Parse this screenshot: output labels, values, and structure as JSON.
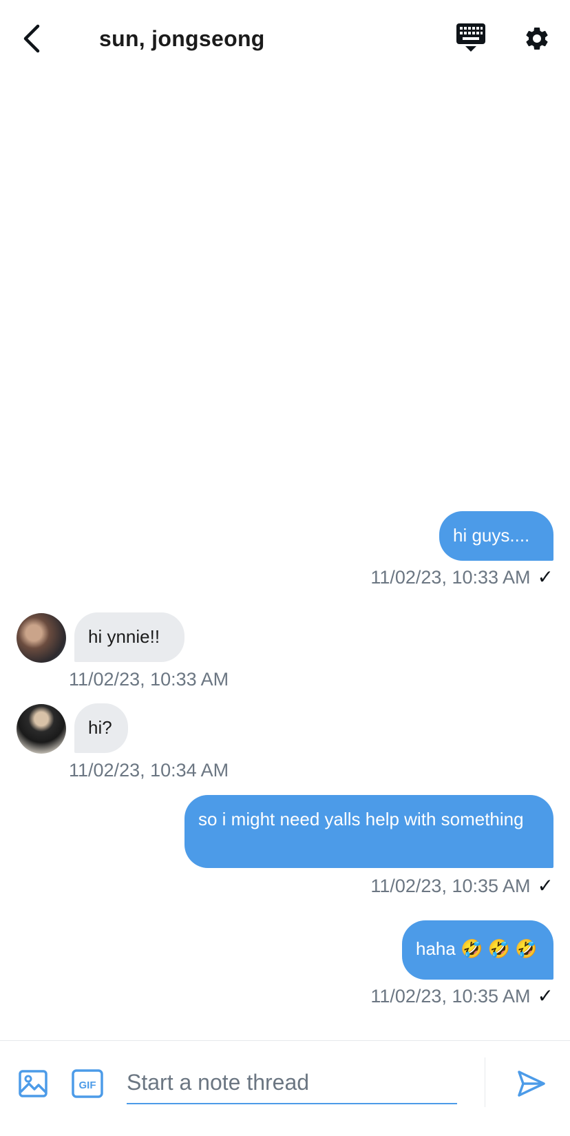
{
  "header": {
    "title": "sun, jongseong",
    "back_icon": "chevron-left-icon",
    "keyboard_icon": "keyboard-icon",
    "settings_icon": "gear-icon"
  },
  "messages": [
    {
      "direction": "outgoing",
      "text": "hi guys....",
      "timestamp": "11/02/23, 10:33 AM",
      "status": "✓"
    },
    {
      "direction": "incoming",
      "text": "hi ynnie!!",
      "timestamp": "11/02/23, 10:33 AM"
    },
    {
      "direction": "incoming",
      "text": "hi?",
      "timestamp": "11/02/23, 10:34 AM"
    },
    {
      "direction": "outgoing",
      "text": "so i might need yalls help with something",
      "timestamp": "11/02/23, 10:35 AM",
      "status": "✓"
    },
    {
      "direction": "outgoing",
      "text": "haha 🤣 🤣 🤣",
      "timestamp": "11/02/23, 10:35 AM",
      "status": "✓"
    }
  ],
  "composer": {
    "placeholder": "Start a note thread",
    "value": "",
    "image_icon": "image-icon",
    "gif_label": "GIF",
    "send_icon": "send-icon"
  },
  "colors": {
    "accent": "#4c9be8",
    "incoming_bubble": "#e9ebee",
    "timestamp": "#6b7682"
  }
}
